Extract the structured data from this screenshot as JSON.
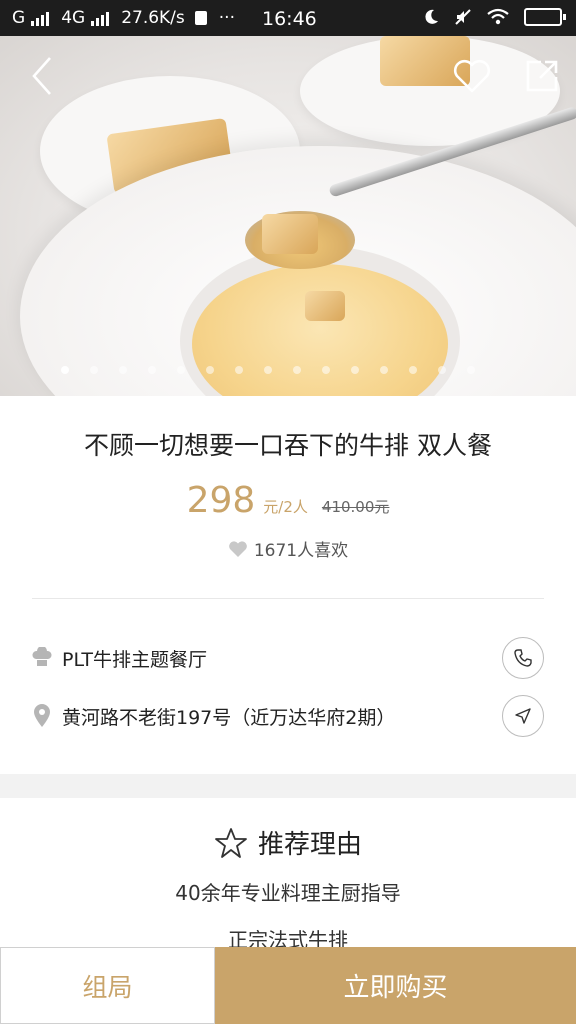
{
  "status_bar": {
    "network_left": "G",
    "network_4g": "4G",
    "speed": "27.6K/s",
    "more": "···",
    "time": "16:46"
  },
  "hero": {
    "back_icon": "back-arrow-icon",
    "favorite_icon": "heart-outline-icon",
    "share_icon": "share-icon",
    "carousel_count": 15,
    "carousel_active_index": 0
  },
  "product": {
    "title": "不顾一切想要一口吞下的牛排 双人餐",
    "price": "298",
    "price_unit": "元/2人",
    "original_price": "410.00元",
    "likes": "1671人喜欢"
  },
  "restaurant": {
    "name": "PLT牛排主题餐厅",
    "address": "黄河路不老街197号（近万达华府2期）",
    "call_icon": "phone-icon",
    "navigate_icon": "navigation-arrow-icon"
  },
  "recommend": {
    "title": "推荐理由",
    "reasons": [
      "40余年专业料理主厨指导",
      "正宗法式牛排"
    ]
  },
  "bottom": {
    "group_label": "组局",
    "buy_label": "立即购买"
  },
  "colors": {
    "accent": "#c9a46a",
    "status_bar": "#1d1d1d",
    "band": "#f2f2f2"
  }
}
